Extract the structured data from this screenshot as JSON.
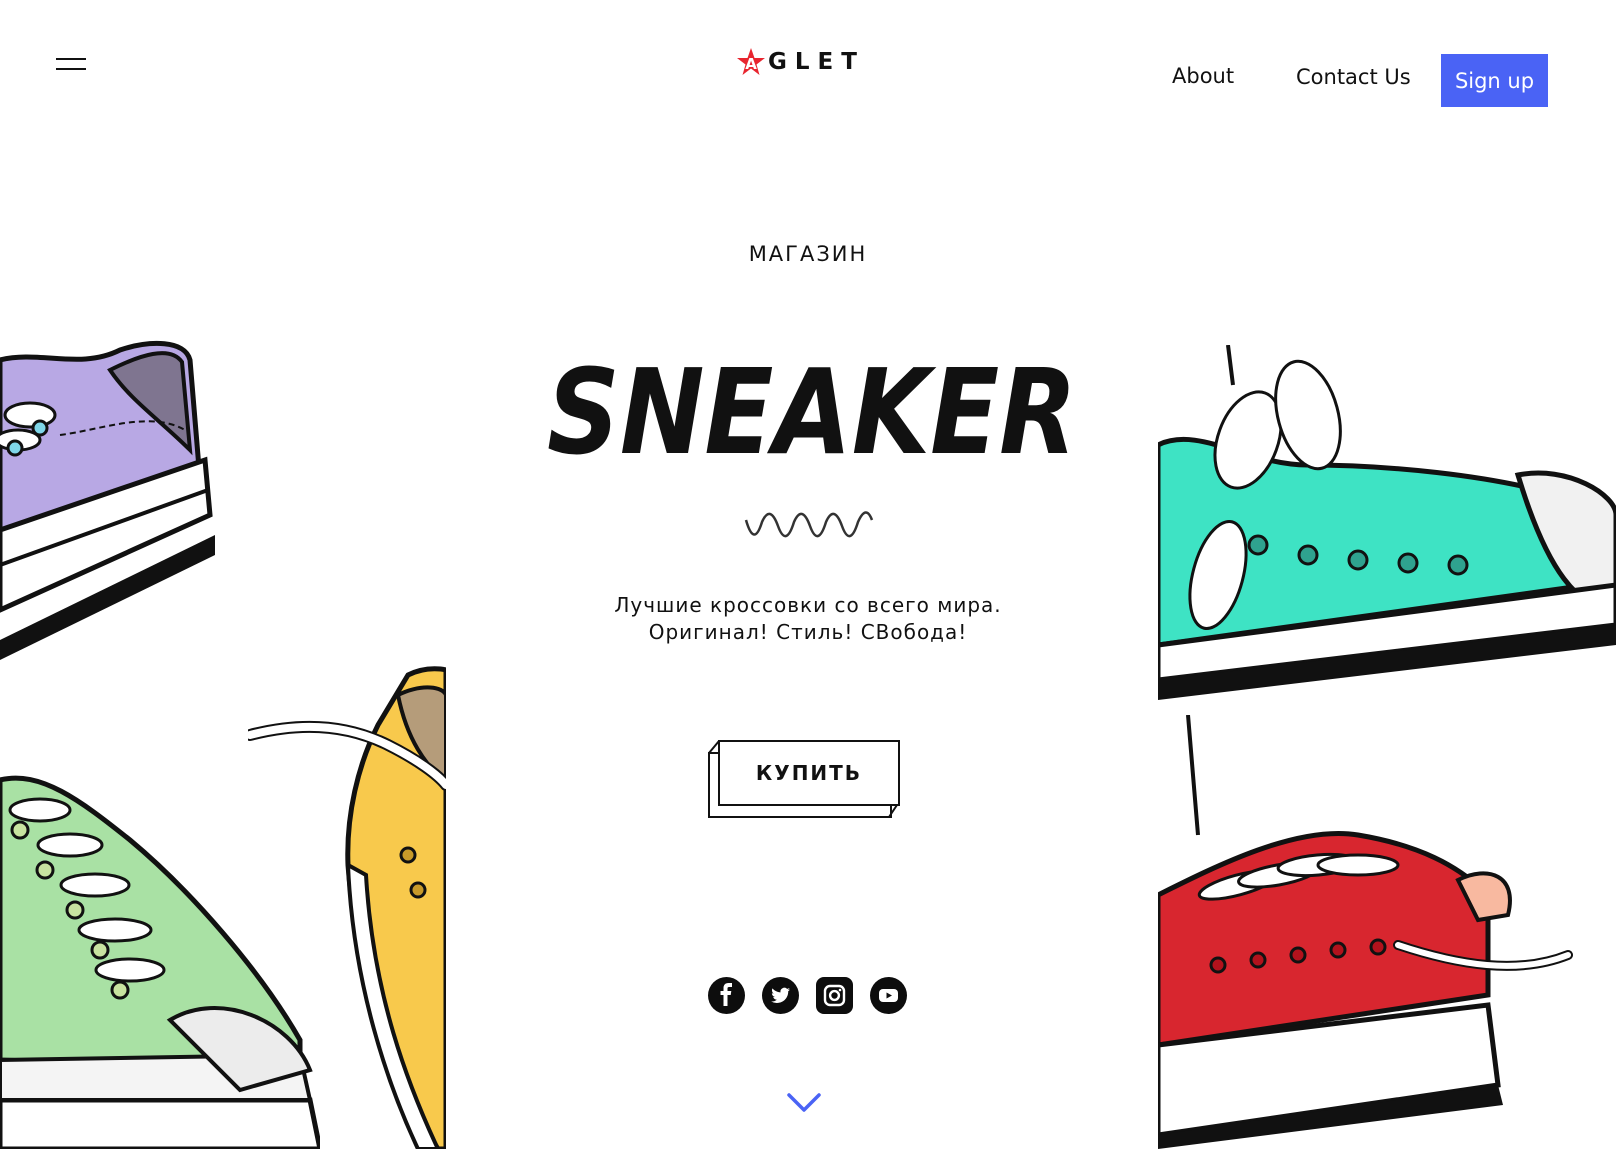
{
  "header": {
    "menu_icon": "hamburger-menu-icon",
    "logo": {
      "text": "GLET",
      "mark_letter": "A",
      "mark_color": "#e8252f",
      "mark_inner": "#2948a8"
    },
    "nav": [
      {
        "label": "About"
      },
      {
        "label": "Contact Us"
      }
    ],
    "signup_label": "Sign up",
    "accent_color": "#4a63f5"
  },
  "hero": {
    "kicker": "МАГАЗИН",
    "title": "SNEAKER",
    "tagline_line1": "Лучшие кроссовки со всего мира.",
    "tagline_line2": "Оригинал! Стиль! СВобода!",
    "buy_label": "КУПИТЬ"
  },
  "socials": [
    {
      "icon": "facebook-icon"
    },
    {
      "icon": "twitter-icon"
    },
    {
      "icon": "instagram-icon"
    },
    {
      "icon": "youtube-icon"
    }
  ],
  "scroll_icon": "chevron-down-icon",
  "shoe_colors": {
    "purple": "#b8a8e4",
    "green": "#a9e1a4",
    "yellow": "#f8c94c",
    "teal": "#3ee3c4",
    "red": "#d8262f"
  }
}
